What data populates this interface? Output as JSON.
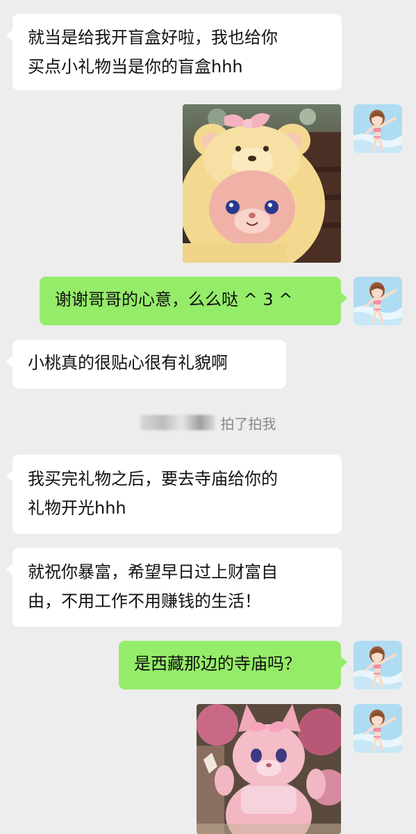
{
  "messages": [
    {
      "id": "m1",
      "side": "in",
      "text_line1": "就当是给我开盲盒好啦，我也给你",
      "text_line2": "买点小礼物当是你的盲盒hhh"
    },
    {
      "id": "m2",
      "side": "out",
      "type": "image",
      "image_desc": "plush-bear-photo"
    },
    {
      "id": "m3",
      "side": "out",
      "text": "谢谢哥哥的心意，么么哒 ^ 3 ^"
    },
    {
      "id": "m4",
      "side": "in",
      "text": "小桃真的很贴心很有礼貌啊"
    },
    {
      "id": "m6",
      "side": "in",
      "text_line1": "我买完礼物之后，要去寺庙给你的",
      "text_line2": "礼物开光hhh"
    },
    {
      "id": "m7",
      "side": "in",
      "text_line1": "就祝你暴富，希望早日过上财富自",
      "text_line2": "由，不用工作不用赚钱的生活！"
    },
    {
      "id": "m8",
      "side": "out",
      "text": "是西藏那边的寺庙吗？"
    },
    {
      "id": "m9",
      "side": "out",
      "type": "image",
      "image_desc": "pink-fox-mascot-photo"
    }
  ],
  "system_notice": {
    "action_text": "拍了拍我"
  },
  "colors": {
    "background": "#ededed",
    "incoming_bubble": "#ffffff",
    "outgoing_bubble": "#95ec69",
    "system_text": "#8a8a8a"
  }
}
